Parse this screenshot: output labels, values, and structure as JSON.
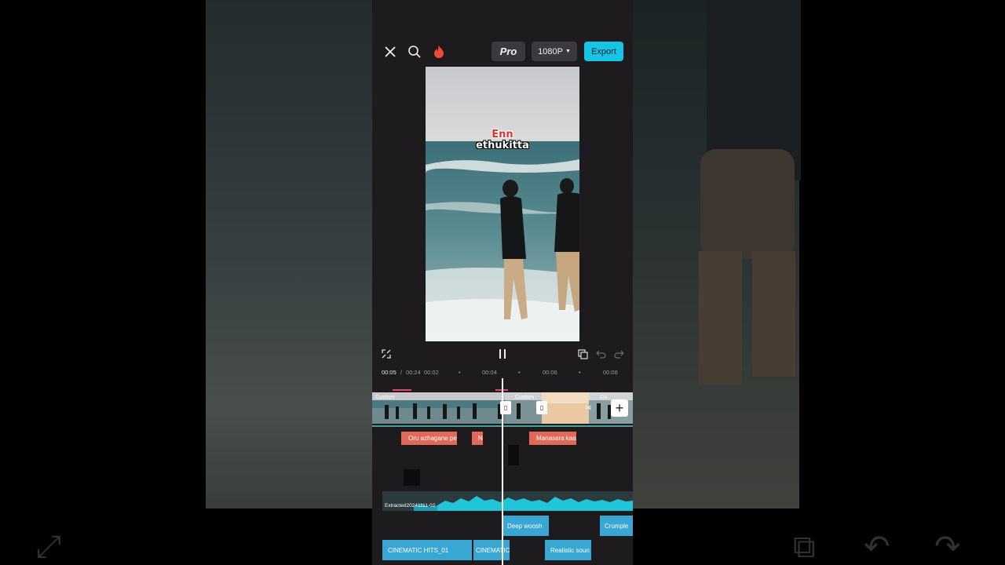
{
  "topbar": {
    "close_icon": "close-icon",
    "search_icon": "search-icon",
    "fire_icon": "fire-icon",
    "pro_label": "Pro",
    "resolution_label": "1080P",
    "export_label": "Export"
  },
  "preview": {
    "caption_line1": "Enn",
    "caption_line2": "ethukitta"
  },
  "controls": {
    "fullscreen_icon": "fullscreen-icon",
    "pause_icon": "pause-icon",
    "keyframe_icon": "keyframe-icon",
    "undo_icon": "undo-icon",
    "redo_icon": "redo-icon"
  },
  "timeline": {
    "current_time": "00:05",
    "separator": "/",
    "total_time": "00:24",
    "ticks": [
      "00:02",
      "00:04",
      "00:06",
      "00:08"
    ],
    "clip_labels": [
      "Custom",
      "Custom",
      "Cu"
    ],
    "add_symbol": "+",
    "text_clips": [
      "Oru azhagane pe",
      "N",
      "Manasara kaa"
    ],
    "audio_label": "Extracted20241111-02",
    "sfx": [
      "Deep woosh",
      "Crumple",
      "CINEMATIC HITS_01",
      "CINEMATIC",
      "Realistic soun"
    ]
  },
  "colors": {
    "accent": "#16c4e6",
    "text_clip": "#e06a57",
    "sfx_clip": "#3aa6d4",
    "panel_bg": "#1e1b1f"
  }
}
